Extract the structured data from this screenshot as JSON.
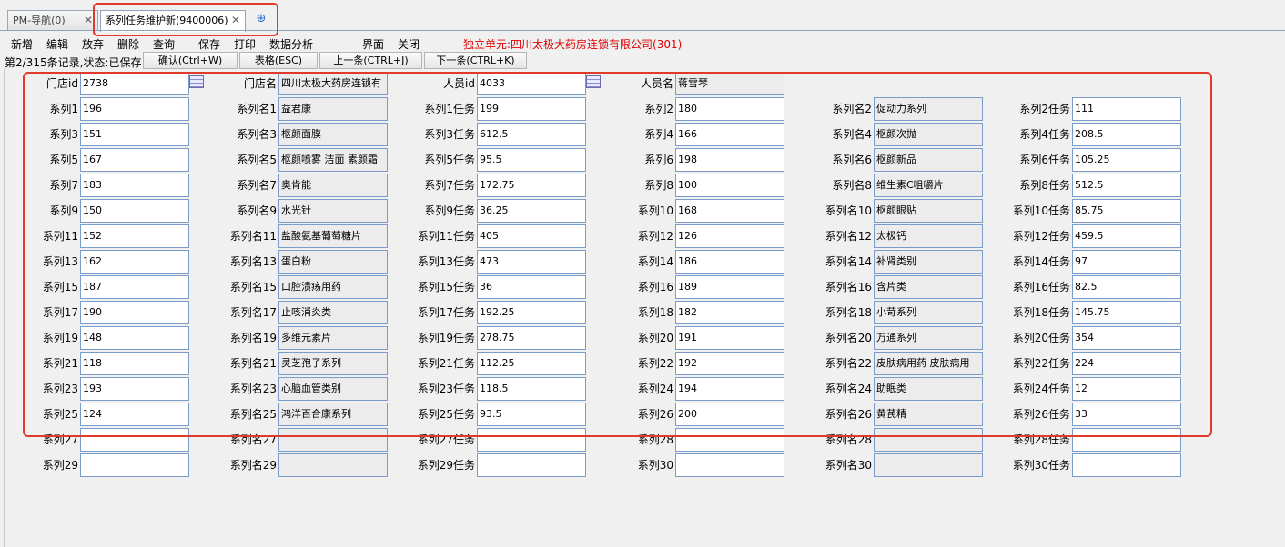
{
  "tabs": [
    {
      "label": "PM-导航(0)"
    },
    {
      "label": "系列任务维护新(9400006)"
    }
  ],
  "toolbar": {
    "items": [
      "新增",
      "编辑",
      "放弃",
      "删除",
      "查询",
      "保存",
      "打印",
      "数据分析",
      "界面",
      "关闭"
    ],
    "unit_text": "独立单元:四川太极大药房连锁有限公司(301)"
  },
  "status": {
    "text": "第2/315条记录,状态:已保存",
    "buttons": [
      "确认(Ctrl+W)",
      "表格(ESC)",
      "上一条(CTRL+J)",
      "下一条(CTRL+K)"
    ]
  },
  "header_fields": {
    "store_id_label": "门店id",
    "store_id": "2738",
    "store_name_label": "门店名",
    "store_name": "四川太极大药房连锁有",
    "staff_id_label": "人员id",
    "staff_id": "4033",
    "staff_name_label": "人员名",
    "staff_name": "蒋雪琴"
  },
  "rows": [
    [
      {
        "l": "系列1",
        "v": "196"
      },
      {
        "l": "系列名1",
        "v": "益君康"
      },
      {
        "l": "系列1任务",
        "v": "199"
      },
      {
        "l": "系列2",
        "v": "180"
      },
      {
        "l": "系列名2",
        "v": "促动力系列"
      },
      {
        "l": "系列2任务",
        "v": "111"
      }
    ],
    [
      {
        "l": "系列3",
        "v": "151"
      },
      {
        "l": "系列名3",
        "v": "枢颜面膜"
      },
      {
        "l": "系列3任务",
        "v": "612.5"
      },
      {
        "l": "系列4",
        "v": "166"
      },
      {
        "l": "系列名4",
        "v": "枢颜次抛"
      },
      {
        "l": "系列4任务",
        "v": "208.5"
      }
    ],
    [
      {
        "l": "系列5",
        "v": "167"
      },
      {
        "l": "系列名5",
        "v": "枢颜喷雾 洁面 素颜霜"
      },
      {
        "l": "系列5任务",
        "v": "95.5"
      },
      {
        "l": "系列6",
        "v": "198"
      },
      {
        "l": "系列名6",
        "v": "枢颜新品"
      },
      {
        "l": "系列6任务",
        "v": "105.25"
      }
    ],
    [
      {
        "l": "系列7",
        "v": "183"
      },
      {
        "l": "系列名7",
        "v": "奥肯能"
      },
      {
        "l": "系列7任务",
        "v": "172.75"
      },
      {
        "l": "系列8",
        "v": "100"
      },
      {
        "l": "系列名8",
        "v": "维生素C咀嚼片"
      },
      {
        "l": "系列8任务",
        "v": "512.5"
      }
    ],
    [
      {
        "l": "系列9",
        "v": "150"
      },
      {
        "l": "系列名9",
        "v": "水光针"
      },
      {
        "l": "系列9任务",
        "v": "36.25"
      },
      {
        "l": "系列10",
        "v": "168"
      },
      {
        "l": "系列名10",
        "v": "枢颜眼贴"
      },
      {
        "l": "系列10任务",
        "v": "85.75"
      }
    ],
    [
      {
        "l": "系列11",
        "v": "152"
      },
      {
        "l": "系列名11",
        "v": "盐酸氨基葡萄糖片"
      },
      {
        "l": "系列11任务",
        "v": "405"
      },
      {
        "l": "系列12",
        "v": "126"
      },
      {
        "l": "系列名12",
        "v": "太极钙"
      },
      {
        "l": "系列12任务",
        "v": "459.5"
      }
    ],
    [
      {
        "l": "系列13",
        "v": "162"
      },
      {
        "l": "系列名13",
        "v": "蛋白粉"
      },
      {
        "l": "系列13任务",
        "v": "473"
      },
      {
        "l": "系列14",
        "v": "186"
      },
      {
        "l": "系列名14",
        "v": "补肾类别"
      },
      {
        "l": "系列14任务",
        "v": "97"
      }
    ],
    [
      {
        "l": "系列15",
        "v": "187"
      },
      {
        "l": "系列名15",
        "v": "口腔溃疡用药"
      },
      {
        "l": "系列15任务",
        "v": "36"
      },
      {
        "l": "系列16",
        "v": "189"
      },
      {
        "l": "系列名16",
        "v": "含片类"
      },
      {
        "l": "系列16任务",
        "v": "82.5"
      }
    ],
    [
      {
        "l": "系列17",
        "v": "190"
      },
      {
        "l": "系列名17",
        "v": "止咳消炎类"
      },
      {
        "l": "系列17任务",
        "v": "192.25"
      },
      {
        "l": "系列18",
        "v": "182"
      },
      {
        "l": "系列名18",
        "v": "小苛系列"
      },
      {
        "l": "系列18任务",
        "v": "145.75"
      }
    ],
    [
      {
        "l": "系列19",
        "v": "148"
      },
      {
        "l": "系列名19",
        "v": "多维元素片"
      },
      {
        "l": "系列19任务",
        "v": "278.75"
      },
      {
        "l": "系列20",
        "v": "191"
      },
      {
        "l": "系列名20",
        "v": "万通系列"
      },
      {
        "l": "系列20任务",
        "v": "354"
      }
    ],
    [
      {
        "l": "系列21",
        "v": "118"
      },
      {
        "l": "系列名21",
        "v": "灵芝孢子系列"
      },
      {
        "l": "系列21任务",
        "v": "112.25"
      },
      {
        "l": "系列22",
        "v": "192"
      },
      {
        "l": "系列名22",
        "v": "皮肤病用药  皮肤病用"
      },
      {
        "l": "系列22任务",
        "v": "224"
      }
    ],
    [
      {
        "l": "系列23",
        "v": "193"
      },
      {
        "l": "系列名23",
        "v": "心脑血管类别"
      },
      {
        "l": "系列23任务",
        "v": "118.5"
      },
      {
        "l": "系列24",
        "v": "194"
      },
      {
        "l": "系列名24",
        "v": "助眠类"
      },
      {
        "l": "系列24任务",
        "v": "12"
      }
    ],
    [
      {
        "l": "系列25",
        "v": "124"
      },
      {
        "l": "系列名25",
        "v": "鸿洋百合康系列"
      },
      {
        "l": "系列25任务",
        "v": "93.5"
      },
      {
        "l": "系列26",
        "v": "200"
      },
      {
        "l": "系列名26",
        "v": "黄芪精"
      },
      {
        "l": "系列26任务",
        "v": "33"
      }
    ],
    [
      {
        "l": "系列27",
        "v": ""
      },
      {
        "l": "系列名27",
        "v": ""
      },
      {
        "l": "系列27任务",
        "v": ""
      },
      {
        "l": "系列28",
        "v": ""
      },
      {
        "l": "系列名28",
        "v": ""
      },
      {
        "l": "系列28任务",
        "v": ""
      }
    ],
    [
      {
        "l": "系列29",
        "v": ""
      },
      {
        "l": "系列名29",
        "v": ""
      },
      {
        "l": "系列29任务",
        "v": ""
      },
      {
        "l": "系列30",
        "v": ""
      },
      {
        "l": "系列名30",
        "v": ""
      },
      {
        "l": "系列30任务",
        "v": ""
      }
    ]
  ]
}
